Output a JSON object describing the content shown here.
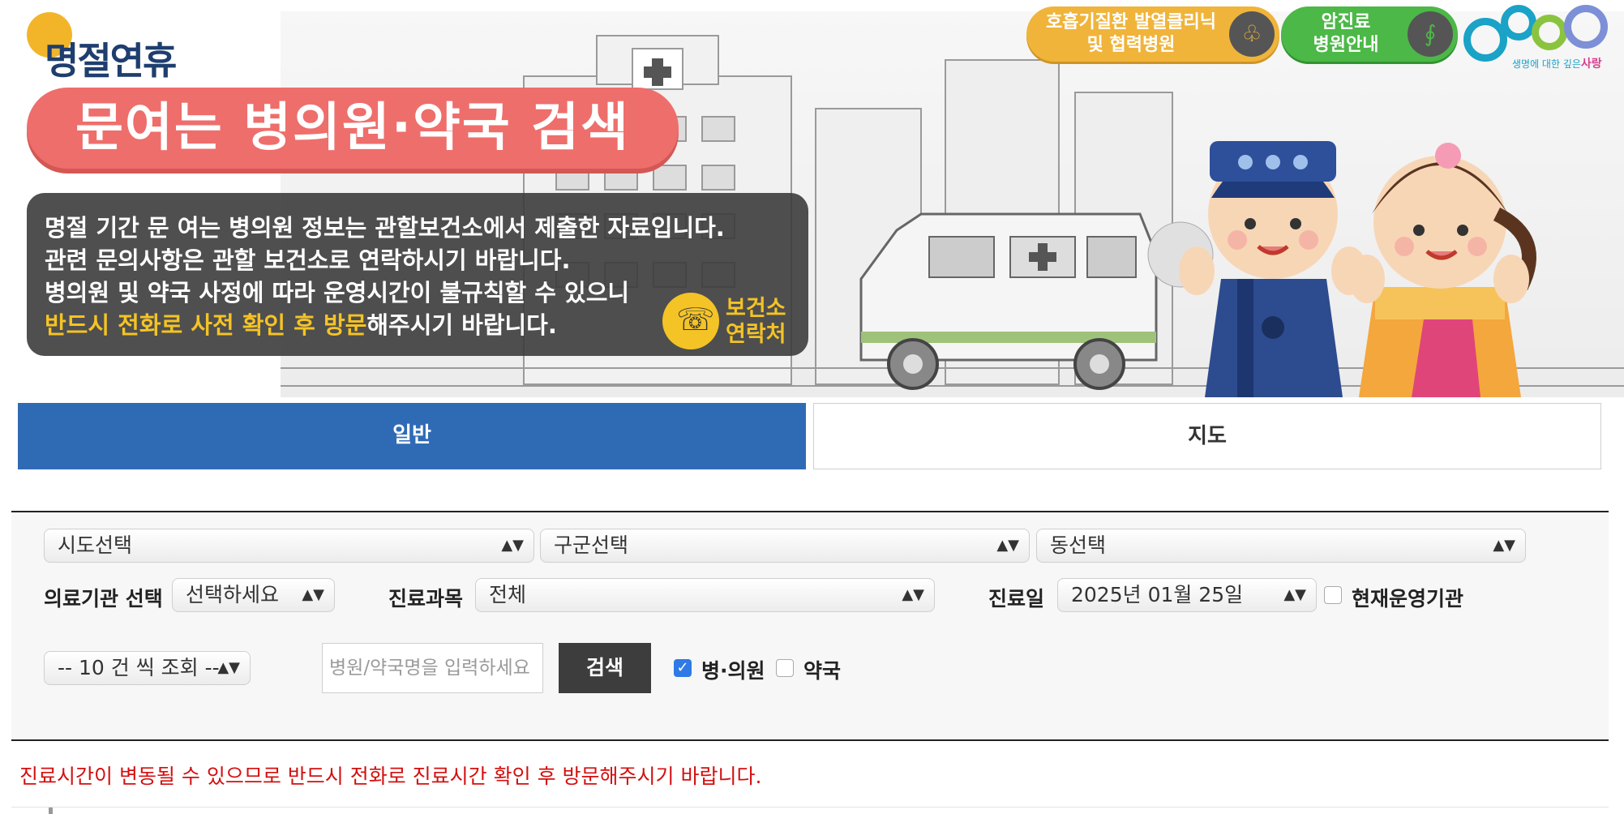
{
  "brand": {
    "name": "명절연휴"
  },
  "banner": {
    "title": "문여는 병의원·약국 검색",
    "notice": {
      "line1": "명절 기간 문 여는 병의원 정보는 관할보건소에서 제출한 자료입니다.",
      "line2": "관련 문의사항은 관할 보건소로 연락하시기 바랍니다.",
      "line3": "병의원 및 약국 사정에 따라 운영시간이 불규칙할 수 있으니",
      "line4_highlight": "반드시 전화로 사전 확인 후 방문",
      "line4_rest": "해주시기 바랍니다."
    },
    "health_center_contact": {
      "line1": "보건소",
      "line2": "연락처",
      "icon": "phone-icon"
    },
    "header_buttons": [
      {
        "line1": "호흡기질환 발열클리닉",
        "line2": "및 협력병원",
        "icon": "lungs-icon",
        "color": "#f0b43b"
      },
      {
        "line1": "암진료",
        "line2": "병원안내",
        "icon": "stethoscope-icon",
        "color": "#4cb847"
      }
    ],
    "egen_logo": {
      "slogan_small": "생명에 대한 깊은",
      "slogan_em": "사랑"
    }
  },
  "tabs": [
    {
      "label": "일반",
      "active": true
    },
    {
      "label": "지도",
      "active": false
    }
  ],
  "search": {
    "sido": "시도선택",
    "gugun": "구군선택",
    "dong": "동선택",
    "institution_label": "의료기관 선택",
    "institution_value": "선택하세요",
    "department_label": "진료과목",
    "department_value": "전체",
    "date_label": "진료일",
    "date_value": "2025년 01월 25일",
    "open_now_label": "현재운영기관",
    "open_now_checked": false,
    "page_size": "-- 10 건 씩 조회 --",
    "name_placeholder": "병원/약국명을 입력하세요",
    "search_button": "검색",
    "type_hospital": {
      "label": "병·의원",
      "checked": true
    },
    "type_pharmacy": {
      "label": "약국",
      "checked": false
    }
  },
  "warning": "진료시간이 변동될 수 있으므로 반드시 전화로 진료시간 확인 후 방문해주시기 바랍니다.",
  "colors": {
    "tab_active": "#2f6bb5",
    "title_pill": "#ee6e6b",
    "highlight": "#f4c326",
    "warning": "#d40f0f"
  }
}
